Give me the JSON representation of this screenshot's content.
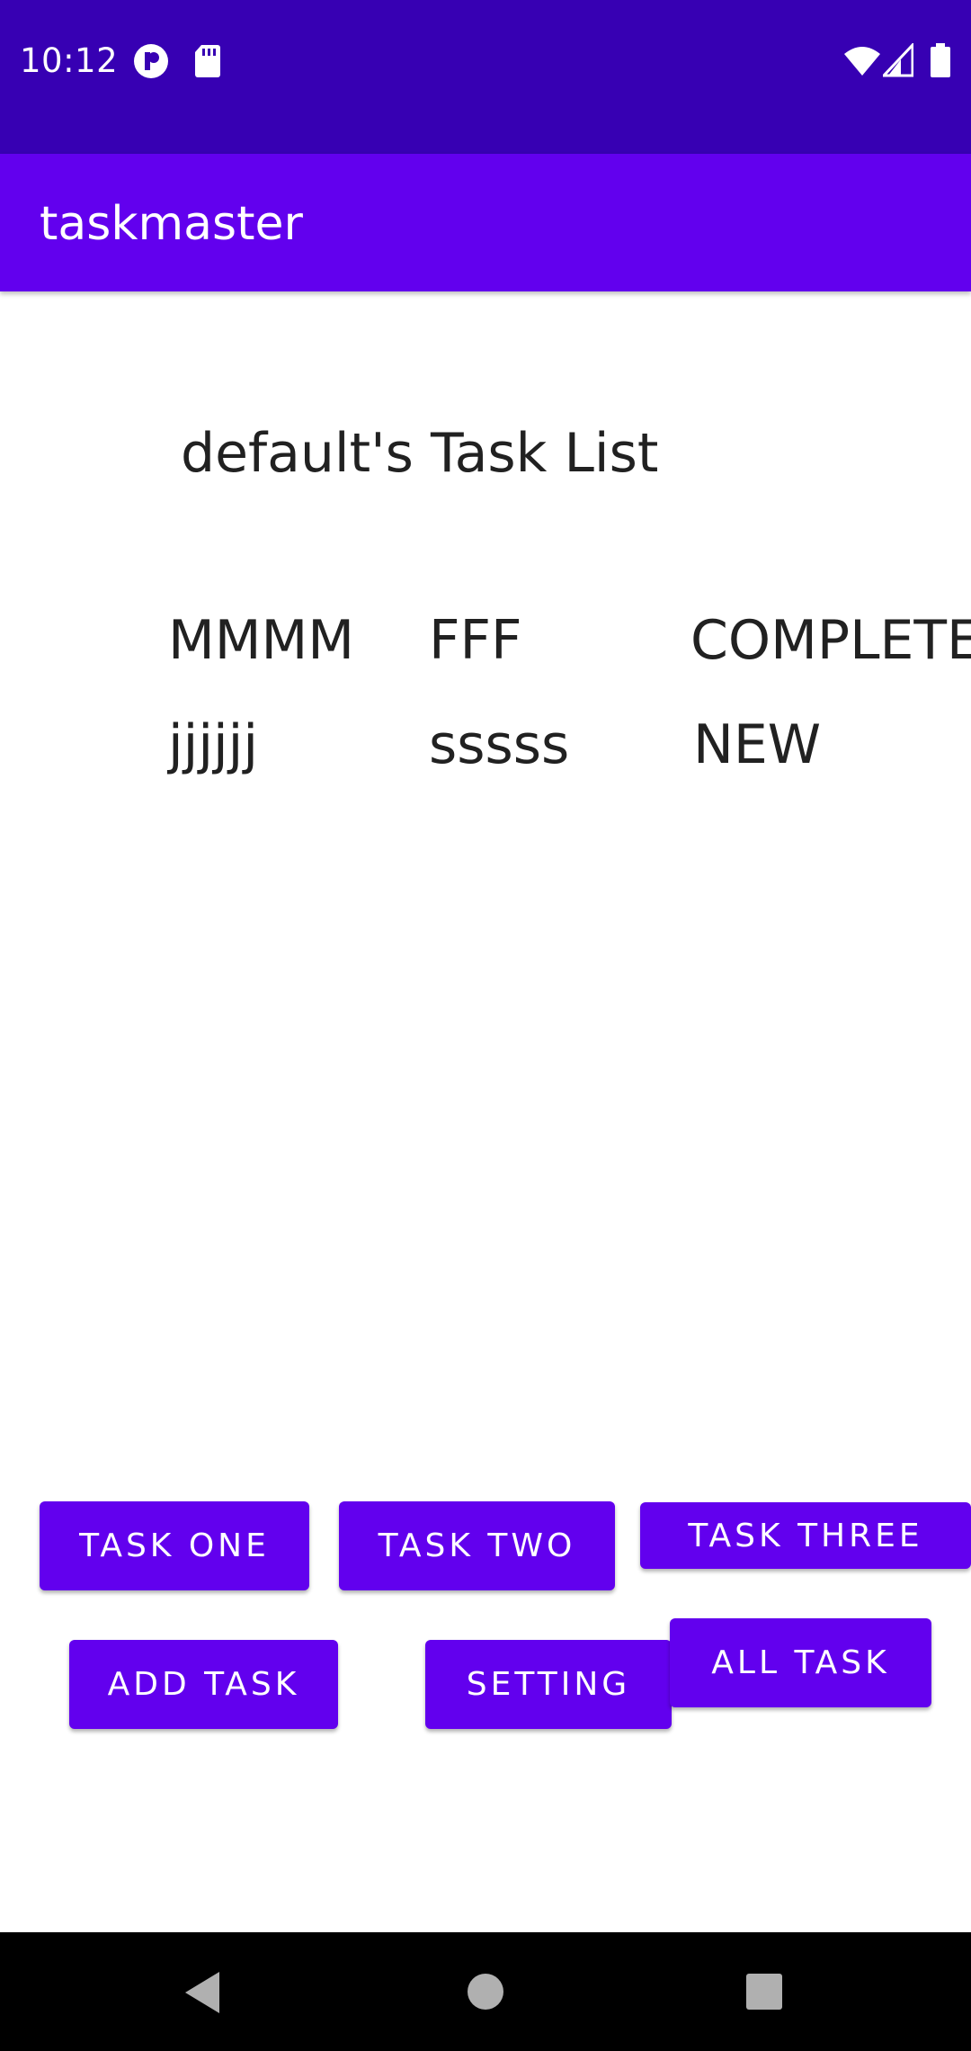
{
  "status_bar": {
    "time": "10:12",
    "left_icons": [
      "notification-app-icon",
      "sd-card-icon"
    ],
    "right_icons": [
      "wifi-icon",
      "signal-icon",
      "battery-icon"
    ],
    "background": "#3700b3"
  },
  "app_bar": {
    "title": "taskmaster",
    "background": "#6200ee"
  },
  "content": {
    "list_title": "default's Task List",
    "tasks": [
      {
        "title": "MMMM",
        "body": "FFF",
        "state": "COMPLETE"
      },
      {
        "title": "jjjjjj",
        "body": "sssss",
        "state": "NEW"
      }
    ]
  },
  "buttons": {
    "task_one": "TASK ONE",
    "task_two": "TASK TWO",
    "task_three": "TASK THREE",
    "add_task": "ADD TASK",
    "setting": "SETTING",
    "all_task": "ALL TASK",
    "color": "#6200ee"
  },
  "nav_bar": {
    "icons": [
      "back-icon",
      "home-icon",
      "recents-icon"
    ]
  }
}
